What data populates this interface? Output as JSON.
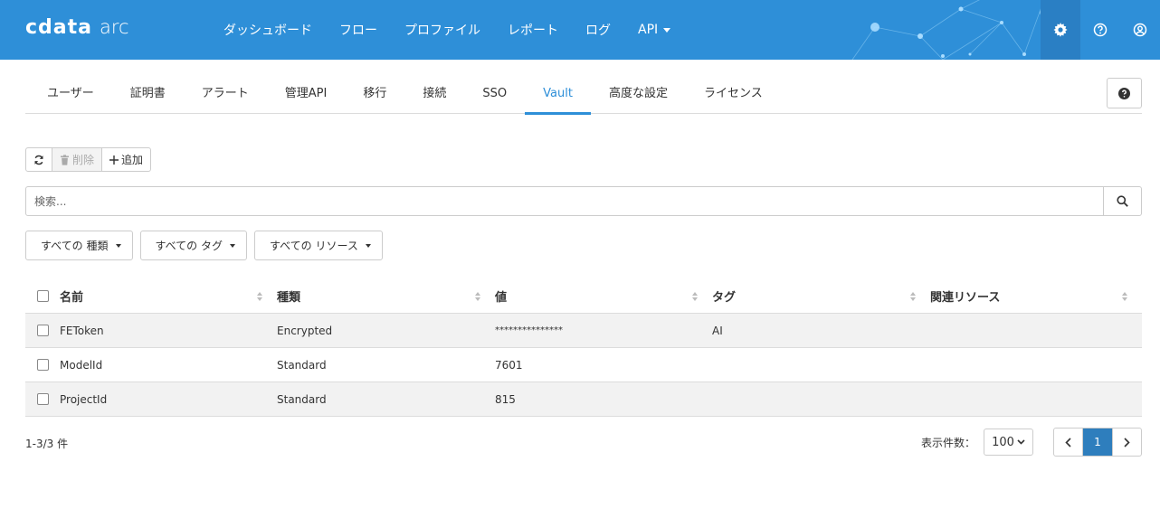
{
  "header": {
    "brand": "cdata",
    "product": "arc",
    "nav": [
      {
        "label": "ダッシュボード"
      },
      {
        "label": "フロー"
      },
      {
        "label": "プロファイル"
      },
      {
        "label": "レポート"
      },
      {
        "label": "ログ"
      },
      {
        "label": "API",
        "dropdown": true
      }
    ],
    "icons": [
      "gear-icon",
      "help-icon",
      "user-icon"
    ]
  },
  "tabs": [
    {
      "label": "ユーザー"
    },
    {
      "label": "証明書"
    },
    {
      "label": "アラート"
    },
    {
      "label": "管理API"
    },
    {
      "label": "移行"
    },
    {
      "label": "接続"
    },
    {
      "label": "SSO"
    },
    {
      "label": "Vault",
      "active": true
    },
    {
      "label": "高度な設定"
    },
    {
      "label": "ライセンス"
    }
  ],
  "toolbar": {
    "refresh_icon": "refresh-icon",
    "delete_label": "削除",
    "add_label": "追加"
  },
  "search": {
    "placeholder": "検索..."
  },
  "filters": {
    "type": "すべての 種類",
    "tag": "すべての タグ",
    "resource": "すべての リソース"
  },
  "table": {
    "columns": [
      "名前",
      "種類",
      "値",
      "タグ",
      "関連リソース"
    ],
    "rows": [
      {
        "name": "FEToken",
        "type": "Encrypted",
        "value": "***************",
        "tag": "AI",
        "resource": ""
      },
      {
        "name": "ModelId",
        "type": "Standard",
        "value": "7601",
        "tag": "",
        "resource": ""
      },
      {
        "name": "ProjectId",
        "type": "Standard",
        "value": "815",
        "tag": "",
        "resource": ""
      }
    ]
  },
  "footer": {
    "count": "1-3/3 件",
    "per_page_label": "表示件数：",
    "per_page_value": "100",
    "current_page": "1"
  },
  "colors": {
    "accent": "#2e8fd8",
    "active_page": "#2e7ebd"
  }
}
